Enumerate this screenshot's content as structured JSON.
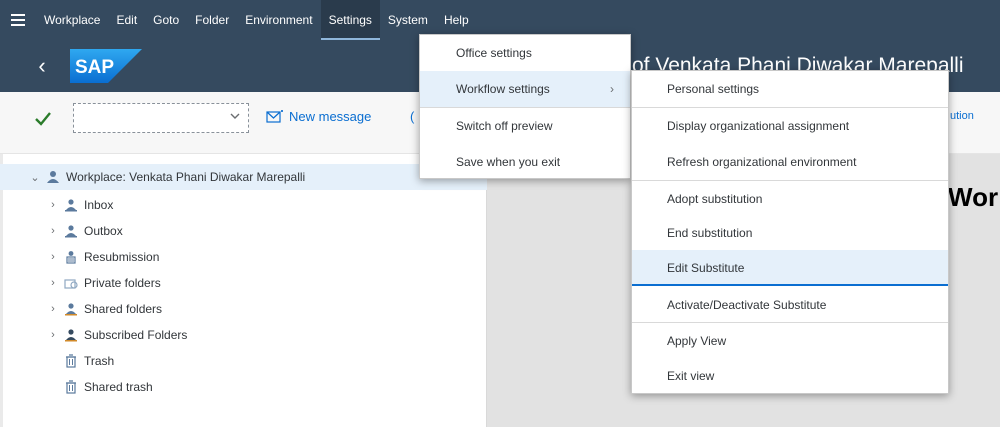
{
  "menubar": {
    "items": [
      "Workplace",
      "Edit",
      "Goto",
      "Folder",
      "Environment",
      "Settings",
      "System",
      "Help"
    ],
    "active": "Settings"
  },
  "titlebar": {
    "logo_text": "SAP",
    "title": "of Venkata Phani Diwakar Marepalli"
  },
  "toolbar": {
    "combo_value": "",
    "new_message_label": "New message",
    "right_link": "ution"
  },
  "tree": {
    "root_label": "Workplace: Venkata Phani Diwakar Marepalli",
    "items": [
      {
        "label": "Inbox",
        "expandable": true
      },
      {
        "label": "Outbox",
        "expandable": true
      },
      {
        "label": "Resubmission",
        "expandable": true
      },
      {
        "label": "Private folders",
        "expandable": true
      },
      {
        "label": "Shared folders",
        "expandable": true
      },
      {
        "label": "Subscribed Folders",
        "expandable": true
      },
      {
        "label": "Trash",
        "expandable": false
      },
      {
        "label": "Shared trash",
        "expandable": false
      }
    ]
  },
  "content": {
    "heading": "Wor"
  },
  "settings_menu": {
    "items": [
      "Office settings",
      "Workflow settings",
      "Switch off preview",
      "Save when you exit"
    ],
    "hover": "Workflow settings"
  },
  "workflow_menu": {
    "items": [
      "Personal settings",
      "Display organizational assignment",
      "Refresh organizational environment",
      "Adopt substitution",
      "End substitution",
      "Edit Substitute",
      "Activate/Deactivate Substitute",
      "Apply View",
      "Exit view"
    ],
    "selected": "Edit Substitute"
  },
  "colors": {
    "shell": "#354a5f",
    "accent": "#0a6ed1",
    "selection": "#e5f0fa"
  }
}
